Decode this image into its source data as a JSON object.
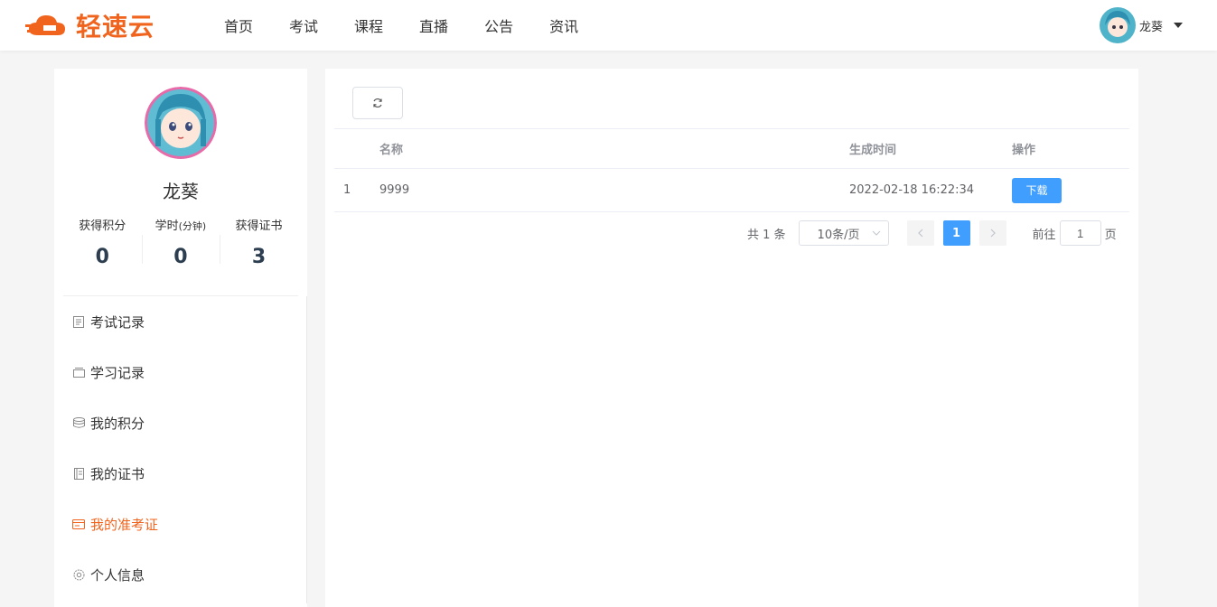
{
  "header": {
    "logo_text": "轻速云",
    "nav": [
      "首页",
      "考试",
      "课程",
      "直播",
      "公告",
      "资讯"
    ],
    "user_name": "龙葵"
  },
  "sidebar": {
    "name": "龙葵",
    "stats": [
      {
        "label": "获得积分",
        "suffix": "",
        "value": "0"
      },
      {
        "label": "学时",
        "suffix": "(分钟)",
        "value": "0"
      },
      {
        "label": "获得证书",
        "suffix": "",
        "value": "3"
      }
    ],
    "menu": [
      {
        "label": "考试记录",
        "icon": "document-icon"
      },
      {
        "label": "学习记录",
        "icon": "folder-icon"
      },
      {
        "label": "我的积分",
        "icon": "coins-icon"
      },
      {
        "label": "我的证书",
        "icon": "certificate-icon"
      },
      {
        "label": "我的准考证",
        "icon": "card-icon",
        "active": true
      },
      {
        "label": "个人信息",
        "icon": "gear-icon"
      }
    ]
  },
  "table": {
    "headers": {
      "name": "名称",
      "time": "生成时间",
      "op": "操作"
    },
    "rows": [
      {
        "index": "1",
        "name": "9999",
        "time": "2022-02-18 16:22:34",
        "action": "下载"
      }
    ]
  },
  "pagination": {
    "total": "共 1 条",
    "page_size": "10条/页",
    "current": "1",
    "goto_label": "前往",
    "goto_value": "1",
    "page_suffix": "页"
  },
  "colors": {
    "accent": "#f0641e",
    "primary": "#409eff"
  }
}
